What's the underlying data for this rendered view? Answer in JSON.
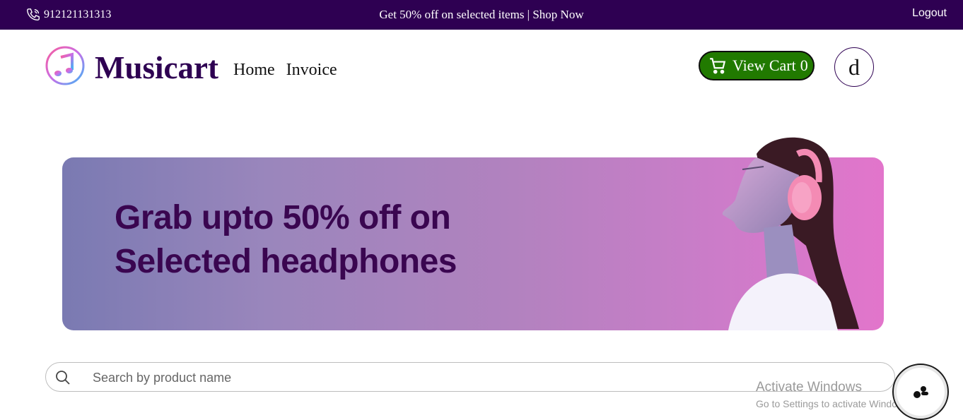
{
  "topbar": {
    "phone": "912121131313",
    "promo_text": "Get 50% off on selected items | ",
    "promo_link": "Shop Now",
    "logout": "Logout"
  },
  "header": {
    "brand": "Musicart",
    "nav": [
      "Home",
      "Invoice"
    ],
    "cart_label": "View Cart",
    "cart_count": "0",
    "avatar_initial": "d"
  },
  "banner": {
    "line1": "Grab upto 50% off on",
    "line2": "Selected headphones"
  },
  "search": {
    "placeholder": "Search by product name"
  },
  "watermark": {
    "title": "Activate Windows",
    "subtitle": "Go to Settings to activate Windows."
  },
  "colors": {
    "brand": "#2e0052",
    "cart_green": "#217a00"
  }
}
